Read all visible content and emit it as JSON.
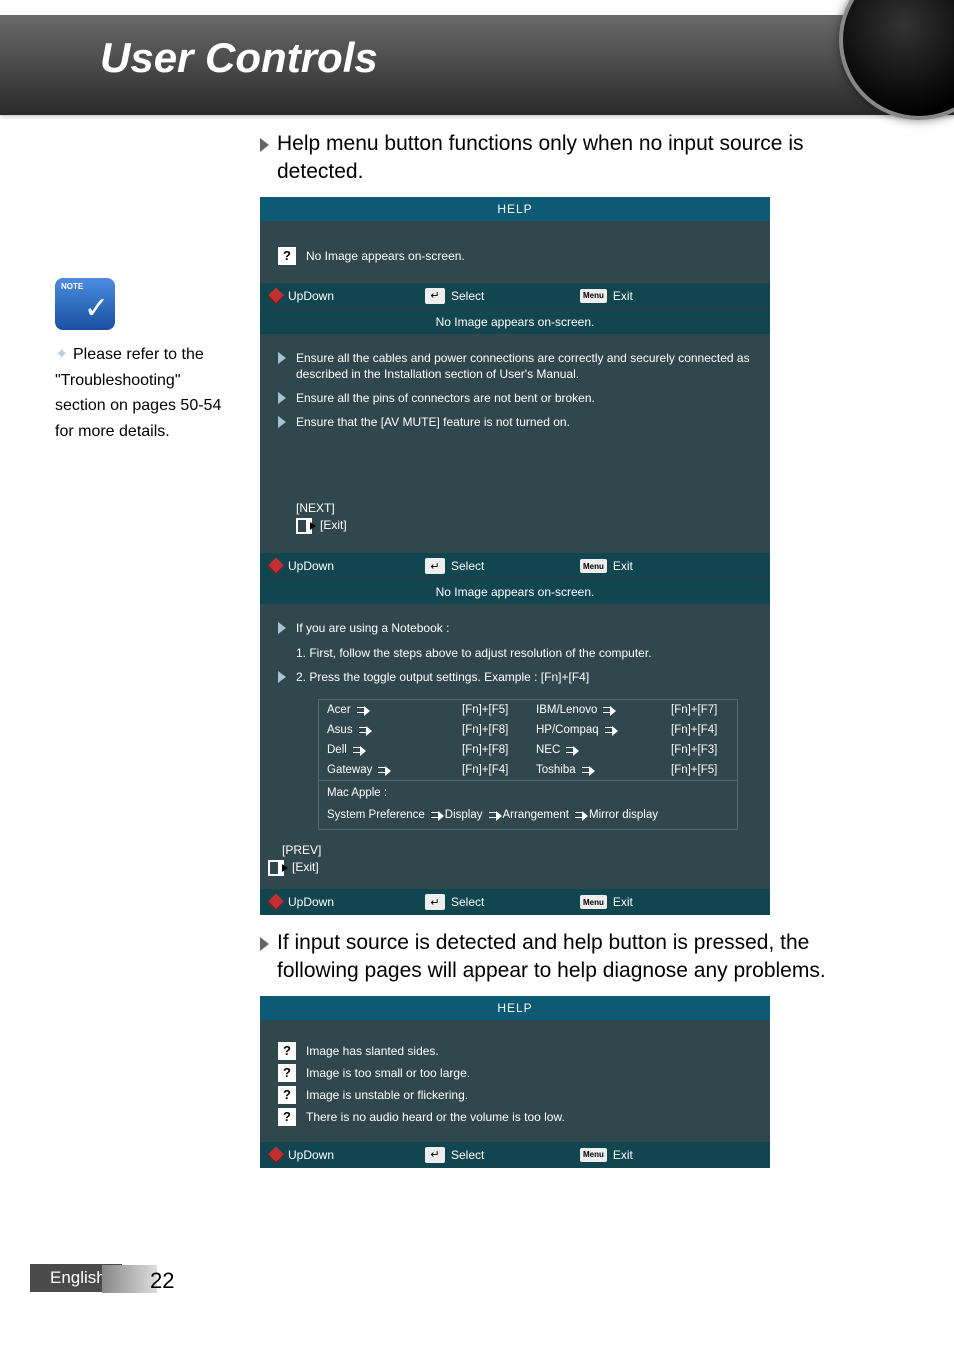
{
  "header": {
    "title": "User Controls"
  },
  "intro1": "Help menu button functions only when no input source is detected.",
  "intro2": "If input source is detected and help button is pressed, the following pages will appear to help diagnose any problems.",
  "note": {
    "label": "NOTE",
    "text": "Please refer to the \"Troubleshooting\" section on pages 50-54 for more details."
  },
  "osd": {
    "help_title": "HELP",
    "topic1": "No Image appears on-screen.",
    "updown": "UpDown",
    "select": "Select",
    "exit": "Exit",
    "menu": "Menu",
    "subtitle": "No Image appears on-screen.",
    "steps1": [
      "Ensure all the cables and power connections are correctly and securely connected as described in the Installation section of User's Manual.",
      "Ensure all the pins of connectors are not bent or broken.",
      "Ensure that the [AV MUTE] feature is not turned on."
    ],
    "next": "[NEXT]",
    "prev": "[PREV]",
    "exit_br": "[Exit]",
    "nb_intro": "If you are using a Notebook :",
    "nb_step1": "1. First, follow the steps above to adjust resolution of the computer.",
    "nb_step2": "2. Press the toggle output settings. Example : [Fn]+[F4]",
    "brands": [
      {
        "name": "Acer",
        "key": "[Fn]+[F5]"
      },
      {
        "name": "Asus",
        "key": "[Fn]+[F8]"
      },
      {
        "name": "Dell",
        "key": "[Fn]+[F8]"
      },
      {
        "name": "Gateway",
        "key": "[Fn]+[F4]"
      }
    ],
    "brands2": [
      {
        "name": "IBM/Lenovo",
        "key": "[Fn]+[F7]"
      },
      {
        "name": "HP/Compaq",
        "key": "[Fn]+[F4]"
      },
      {
        "name": "NEC",
        "key": "[Fn]+[F3]"
      },
      {
        "name": "Toshiba",
        "key": "[Fn]+[F5]"
      }
    ],
    "mac_label": "Mac Apple :",
    "mac_path": [
      "System Preference",
      "Display",
      "Arrangement",
      "Mirror display"
    ],
    "diag_items": [
      "Image has slanted sides.",
      "Image is too small or too large.",
      "Image is unstable or flickering.",
      "There is no audio heard or the volume is too low."
    ]
  },
  "footer": {
    "lang": "English",
    "page": "22"
  }
}
